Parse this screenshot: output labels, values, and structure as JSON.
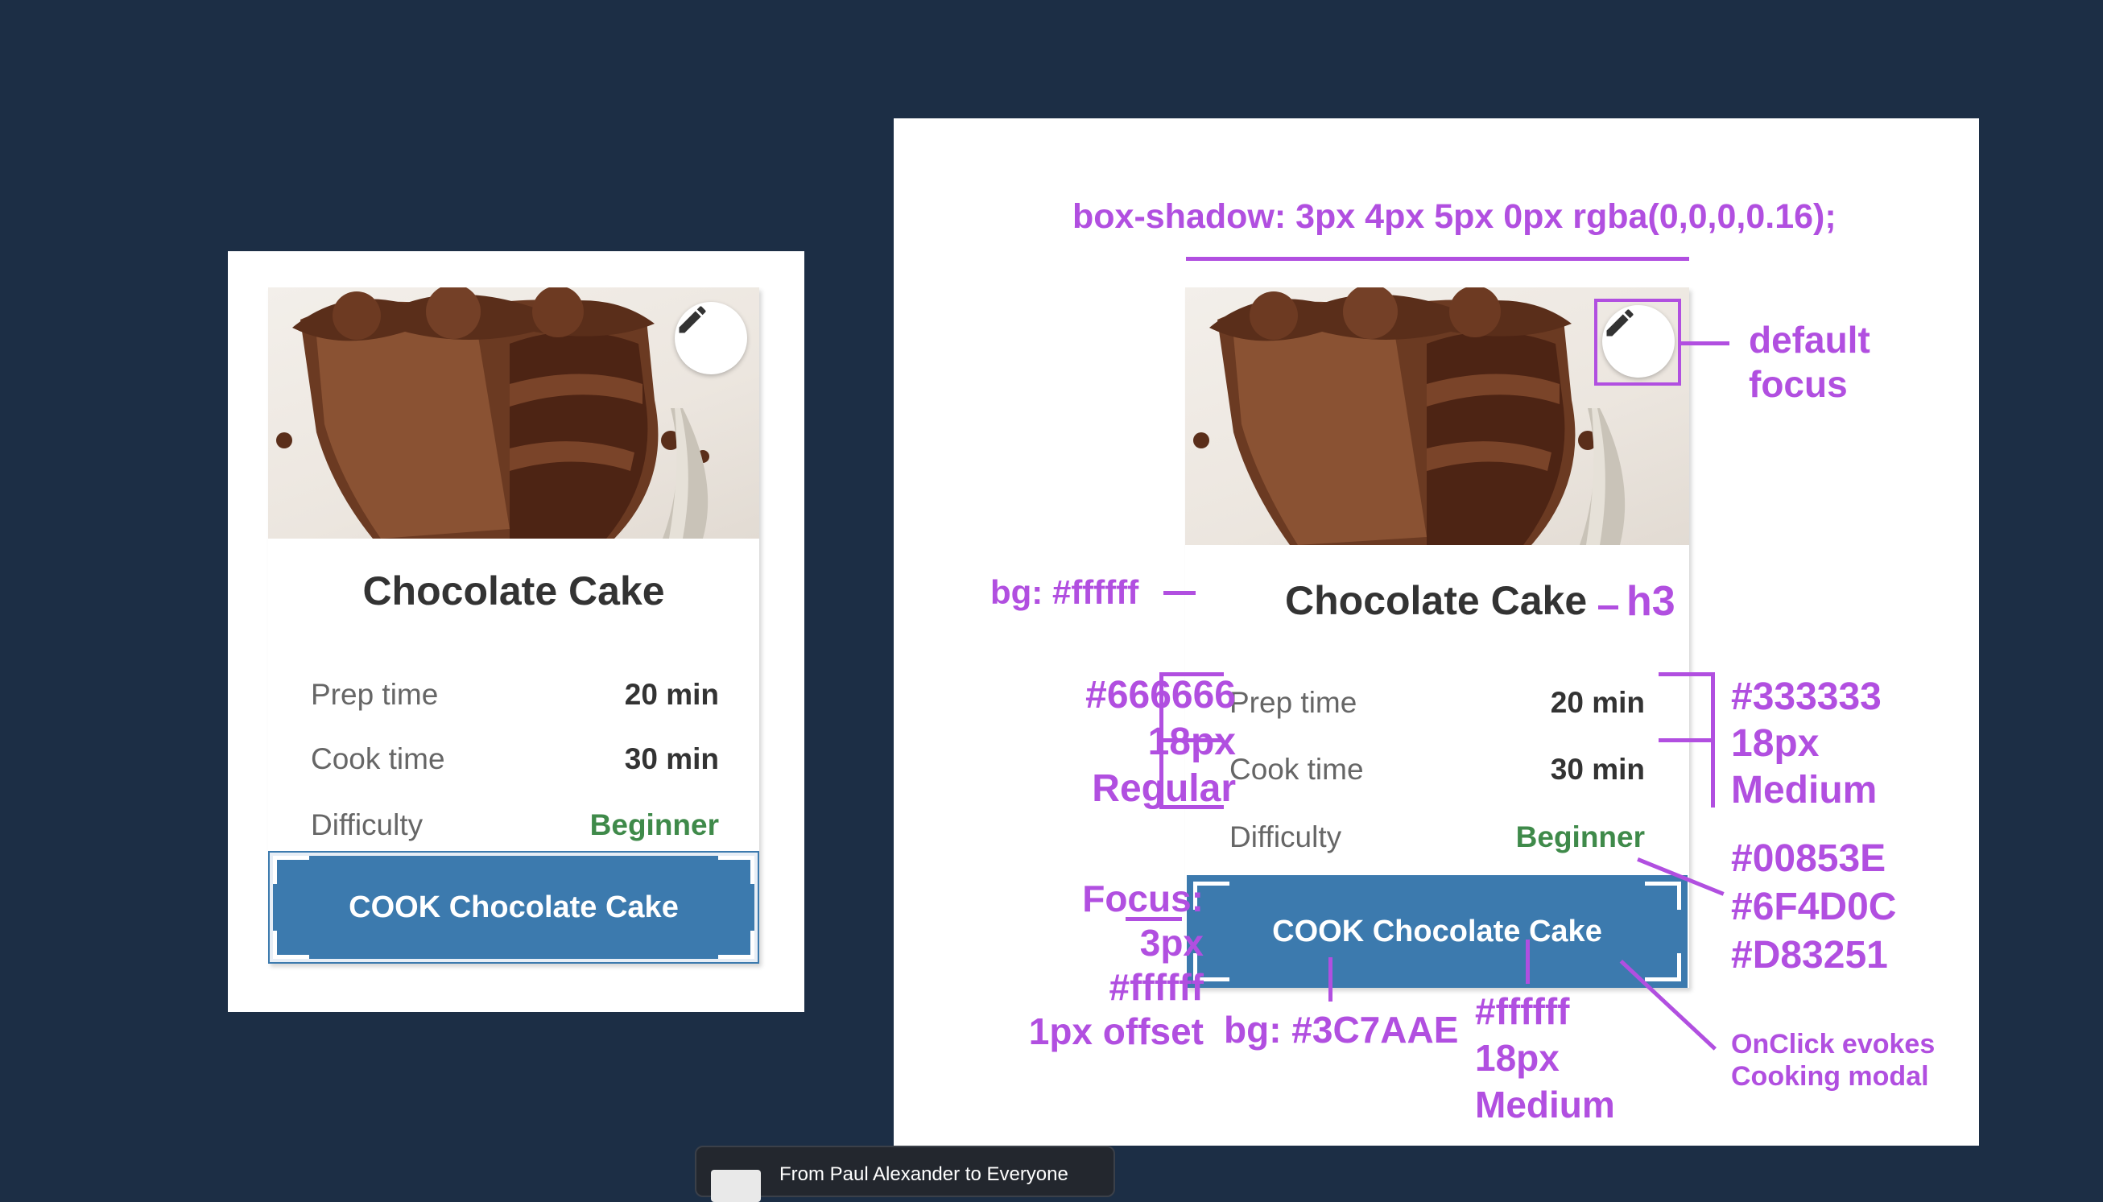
{
  "card": {
    "title": "Chocolate Cake",
    "rows": [
      {
        "label": "Prep time",
        "value": "20 min"
      },
      {
        "label": "Cook time",
        "value": "30 min"
      },
      {
        "label": "Difficulty",
        "value": "Beginner"
      }
    ],
    "button_label": "COOK Chocolate Cake",
    "edit_icon": "pencil-icon"
  },
  "annotations": {
    "box_shadow": "box-shadow: 3px 4px 5px 0px rgba(0,0,0,0.16);",
    "default_focus_line1": "default",
    "default_focus_line2": "focus",
    "bg_white": "bg: #ffffff",
    "h3": "h3",
    "label_color": "#666666",
    "label_size": "18px",
    "label_weight": "Regular",
    "value_color": "#333333",
    "value_size": "18px",
    "value_weight": "Medium",
    "difficulty_colors": [
      "#00853E",
      "#6F4D0C",
      "#D83251"
    ],
    "focus_line1": "Focus:",
    "focus_line2": "3px",
    "focus_line3": "#ffffff",
    "focus_line4": "1px offset",
    "button_bg": "bg: #3C7AAE",
    "button_text_color": "#ffffff",
    "button_text_size": "18px",
    "button_text_weight": "Medium",
    "onclick_line1": "OnClick evokes",
    "onclick_line2": "Cooking modal"
  },
  "chat": {
    "message": "From Paul Alexander to Everyone"
  },
  "colors": {
    "background": "#1c2e45",
    "annotation": "#b14fe0",
    "button": "#3c7aae",
    "beginner": "#3f8a4a"
  }
}
